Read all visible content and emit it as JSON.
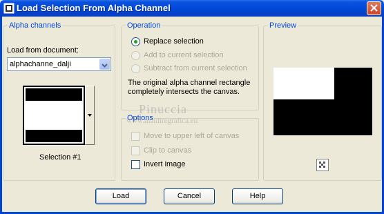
{
  "window": {
    "title": "Load Selection From Alpha Channel"
  },
  "alpha_channels": {
    "legend": "Alpha channels",
    "load_label": "Load from document:",
    "document_value": "alphachanne_dalji",
    "selection_label": "Selection #1"
  },
  "operation": {
    "legend": "Operation",
    "options": [
      {
        "label": "Replace selection",
        "selected": true,
        "enabled": true
      },
      {
        "label": "Add to current selection",
        "selected": false,
        "enabled": false
      },
      {
        "label": "Subtract from current selection",
        "selected": false,
        "enabled": false
      }
    ],
    "description_line1": "The original alpha channel rectangle",
    "description_line2": "completely intersects the canvas."
  },
  "options": {
    "legend": "Options",
    "checkboxes": [
      {
        "label": "Move to upper left of canvas",
        "checked": false,
        "enabled": false
      },
      {
        "label": "Clip to canvas",
        "checked": false,
        "enabled": false
      },
      {
        "label": "Invert image",
        "checked": false,
        "enabled": true
      }
    ]
  },
  "preview": {
    "legend": "Preview"
  },
  "buttons": {
    "load": "Load",
    "cancel": "Cancel",
    "help": "Help"
  },
  "watermark": {
    "line1": "Pinuccia",
    "line2": "www.maidiregrafica.eu"
  },
  "colors": {
    "title_bar": "#0046d5",
    "legend_text": "#0046d5",
    "face": "#ece9d8",
    "radio_dot": "#21a121"
  }
}
